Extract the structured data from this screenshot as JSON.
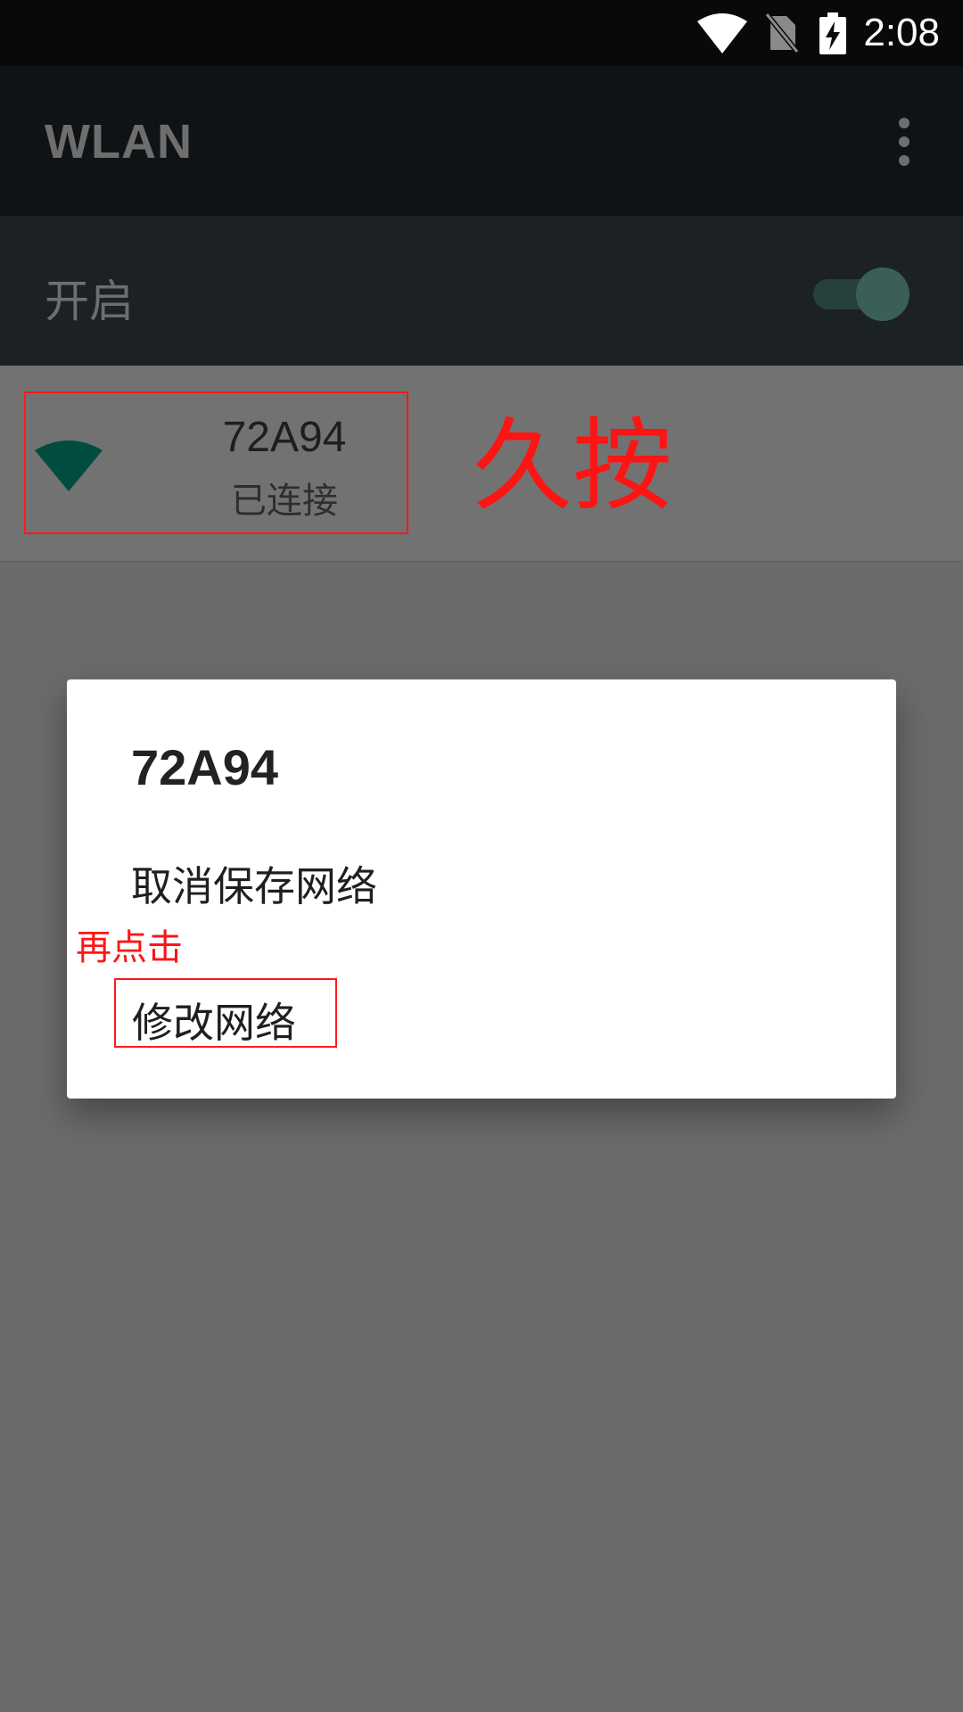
{
  "status_bar": {
    "time": "2:08",
    "icons": [
      "wifi-icon",
      "no-sim-icon",
      "battery-charging-icon"
    ]
  },
  "app_bar": {
    "title": "WLAN",
    "menu_icon": "overflow-menu-icon"
  },
  "wifi_switch": {
    "label": "开启",
    "state": "on"
  },
  "network_list": {
    "items": [
      {
        "ssid": "72A94",
        "status": "已连接",
        "icon": "wifi-signal-icon"
      }
    ]
  },
  "annotations": {
    "long_press": "久按",
    "then_tap": "再点击"
  },
  "dialog": {
    "title": "72A94",
    "options": [
      "取消保存网络",
      "修改网络"
    ]
  },
  "colors": {
    "annotation_red": "#ff1414",
    "accent_teal": "#004d40"
  }
}
